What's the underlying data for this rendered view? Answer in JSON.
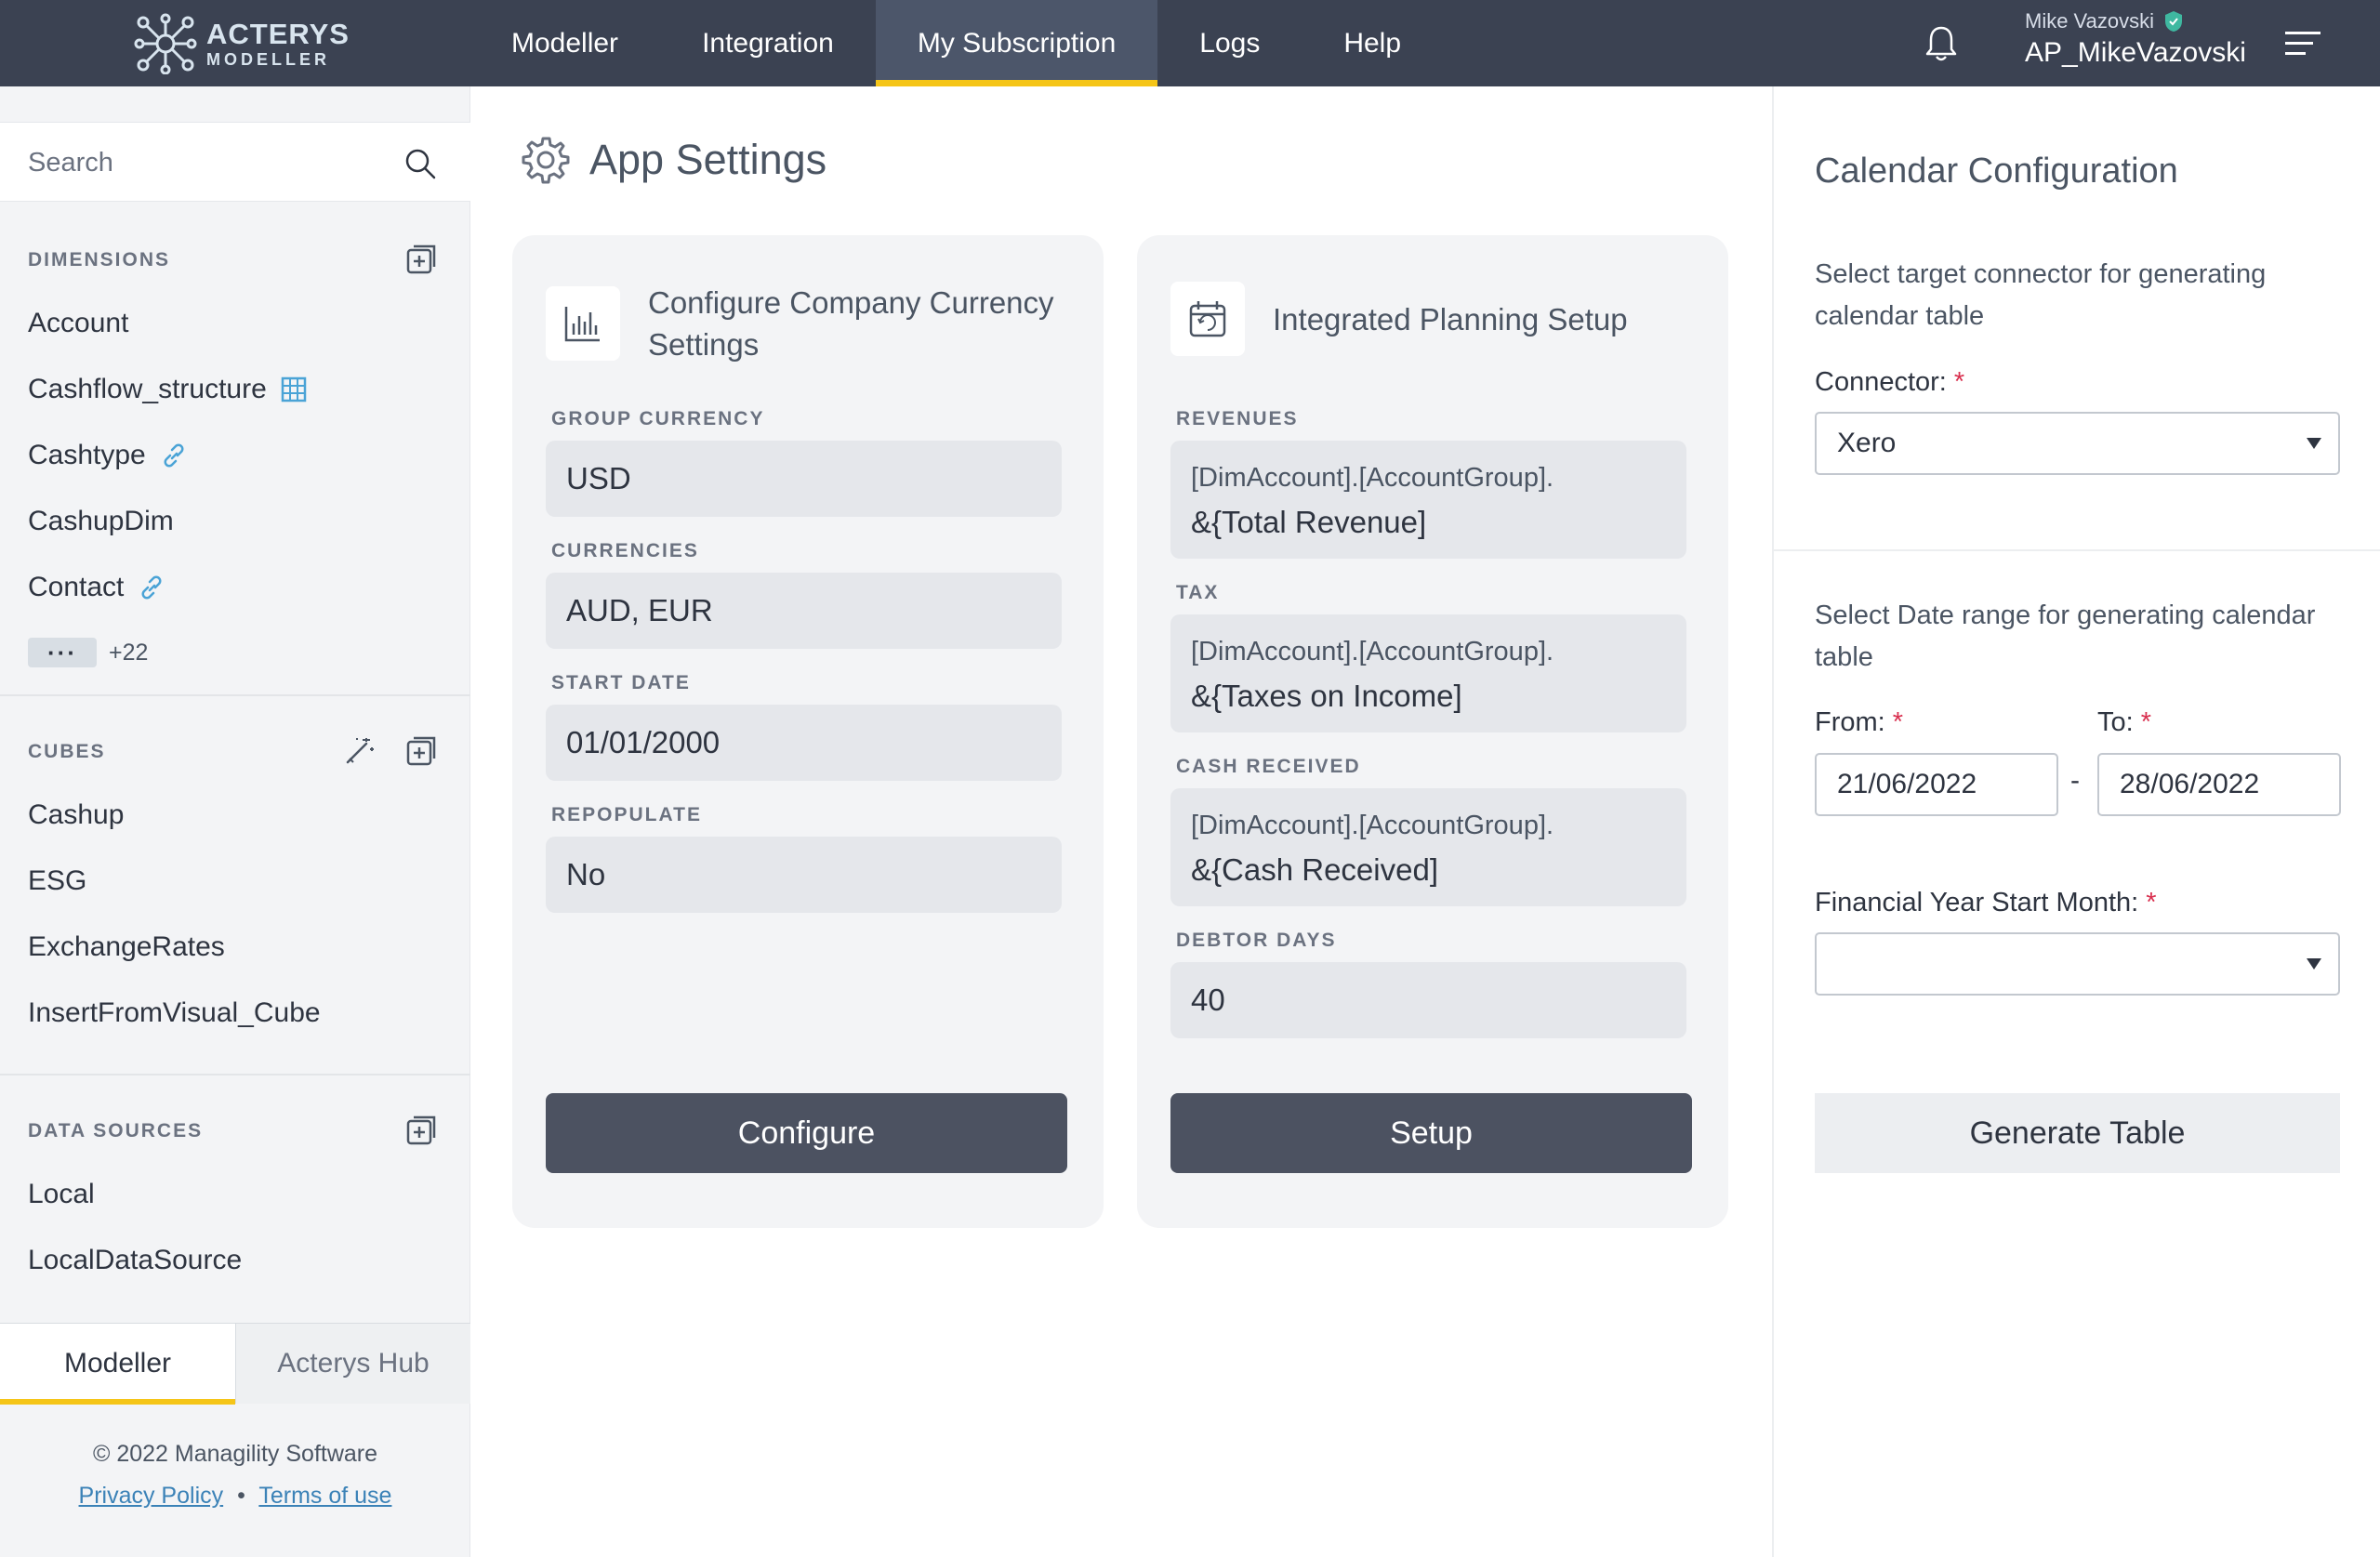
{
  "brand": {
    "name": "ACTERYS",
    "product": "MODELLER"
  },
  "nav": {
    "items": [
      {
        "label": "Modeller"
      },
      {
        "label": "Integration"
      },
      {
        "label": "My Subscription",
        "active": true
      },
      {
        "label": "Logs"
      },
      {
        "label": "Help"
      }
    ]
  },
  "user": {
    "name": "Mike Vazovski",
    "account": "AP_MikeVazovski"
  },
  "sidebar": {
    "search_placeholder": "Search",
    "dimensions": {
      "title": "DIMENSIONS",
      "items": [
        {
          "label": "Account",
          "icon": ""
        },
        {
          "label": "Cashflow_structure",
          "icon": "table-icon"
        },
        {
          "label": "Cashtype",
          "icon": "link-icon"
        },
        {
          "label": "CashupDim",
          "icon": ""
        },
        {
          "label": "Contact",
          "icon": "link-icon"
        }
      ],
      "more_label": "···",
      "more_count": "+22"
    },
    "cubes": {
      "title": "CUBES",
      "items": [
        {
          "label": "Cashup"
        },
        {
          "label": "ESG"
        },
        {
          "label": "ExchangeRates"
        },
        {
          "label": "InsertFromVisual_Cube"
        }
      ]
    },
    "data_sources": {
      "title": "DATA SOURCES",
      "items": [
        {
          "label": "Local"
        },
        {
          "label": "LocalDataSource"
        }
      ]
    },
    "tabs": [
      {
        "label": "Modeller",
        "active": true
      },
      {
        "label": "Acterys Hub"
      }
    ],
    "footer": {
      "copyright": "© 2022 Managility Software",
      "privacy": "Privacy Policy",
      "separator": "•",
      "terms": "Terms of use"
    }
  },
  "main": {
    "title": "App Settings",
    "currency_card": {
      "title": "Configure Company Currency Settings",
      "fields": [
        {
          "label": "GROUP CURRENCY",
          "value": "USD"
        },
        {
          "label": "CURRENCIES",
          "value": "AUD, EUR"
        },
        {
          "label": "START DATE",
          "value": "01/01/2000"
        },
        {
          "label": "REPOPULATE",
          "value": "No"
        }
      ],
      "button": "Configure"
    },
    "planning_card": {
      "title": "Integrated Planning Setup",
      "fields": [
        {
          "label": "REVENUES",
          "line1": "[DimAccount].[AccountGroup].",
          "line2": "&{Total Revenue]"
        },
        {
          "label": "TAX",
          "line1": "[DimAccount].[AccountGroup].",
          "line2": "&{Taxes on Income]"
        },
        {
          "label": "CASH RECEIVED",
          "line1": "[DimAccount].[AccountGroup].",
          "line2": "&{Cash Received]"
        },
        {
          "label": "DEBTOR DAYS",
          "value": "40"
        }
      ],
      "button": "Setup"
    }
  },
  "calendar": {
    "title": "Calendar Configuration",
    "connector_help": "Select target connector for generating calendar table",
    "connector_label": "Connector:",
    "connector_value": "Xero",
    "date_help": "Select Date range for generating calendar table",
    "from_label": "From:",
    "from_value": "21/06/2022",
    "separator": "-",
    "to_label": "To:",
    "to_value": "28/06/2022",
    "fy_label": "Financial Year Start Month:",
    "fy_value": "",
    "required_mark": "*",
    "button": "Generate Table"
  },
  "colors": {
    "topbar": "#3b4252",
    "accent": "#f5c518",
    "button": "#4c5261",
    "link": "#3b82b7",
    "required": "#d9304f"
  }
}
